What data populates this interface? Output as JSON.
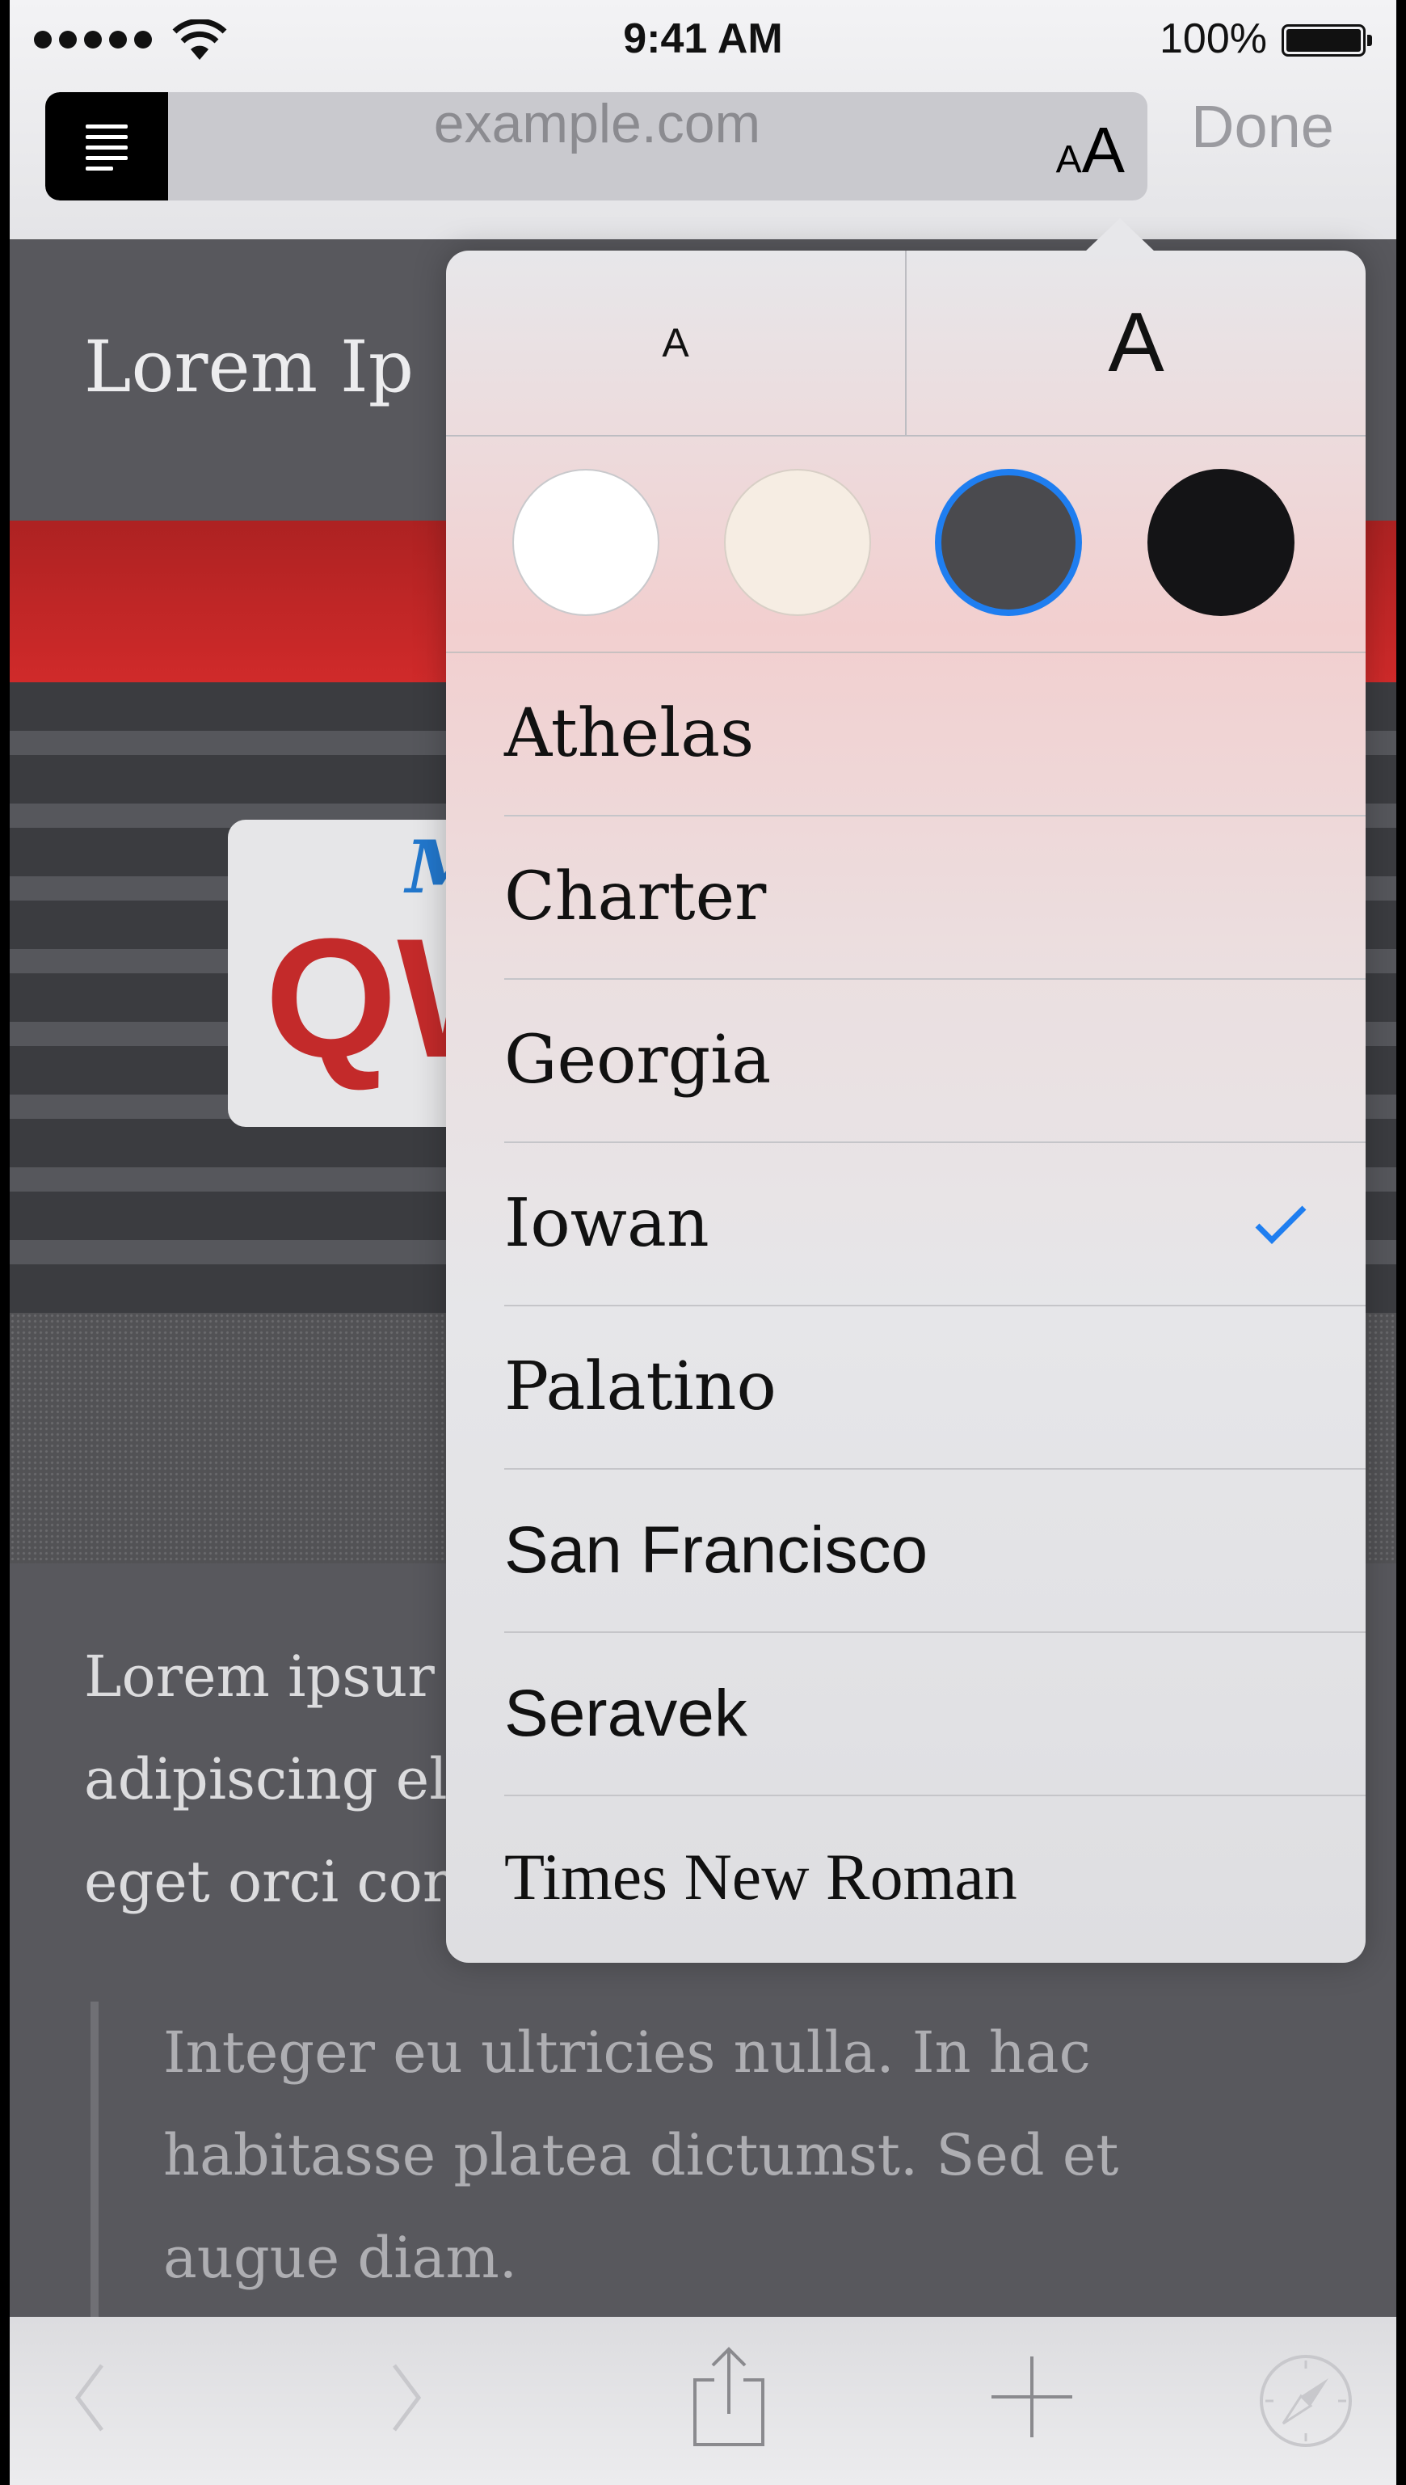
{
  "status_bar": {
    "time": "9:41 AM",
    "battery": "100%"
  },
  "nav": {
    "url": "example.com",
    "aa_small": "A",
    "aa_big": "A",
    "done": "Done"
  },
  "article": {
    "headline": "Lorem Ip",
    "plate_letters": "QW",
    "plate_state": "M",
    "paragraph_lines": [
      "Lorem ipsur",
      "adipiscing el",
      "eget orci cor"
    ],
    "quote_lines": [
      "Integer eu ultricies nulla. In hac",
      "habitasse platea dictumst. Sed et",
      "augue diam."
    ]
  },
  "popover": {
    "smaller_label": "A",
    "larger_label": "A",
    "themes": [
      "white",
      "sepia",
      "gray",
      "black"
    ],
    "selected_theme": "gray",
    "fonts": [
      "Athelas",
      "Charter",
      "Georgia",
      "Iowan",
      "Palatino",
      "San Francisco",
      "Seravek",
      "Times New Roman"
    ],
    "selected_font": "Iowan"
  },
  "colors": {
    "accent": "#1f7ef0"
  },
  "icons": {
    "toolbar": [
      "back-icon",
      "forward-icon",
      "share-icon",
      "add-icon",
      "compass-icon"
    ],
    "reader": "reader-icon"
  }
}
